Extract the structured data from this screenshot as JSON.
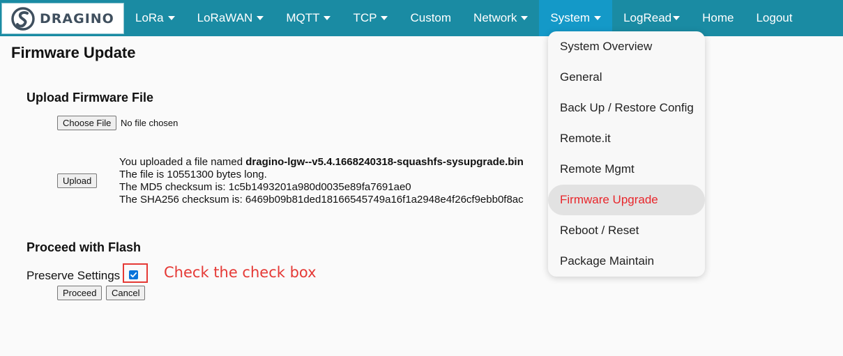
{
  "brand": {
    "logo_text": "DRAGINO",
    "logo_color": "#3f4f5e"
  },
  "colors": {
    "nav_bg": "#1a8ba3",
    "nav_active": "#1499c8",
    "annotation": "#e53935",
    "active_menu_text": "#e8262b"
  },
  "nav": {
    "lora": "LoRa",
    "lorawan": "LoRaWAN",
    "mqtt": "MQTT",
    "tcp": "TCP",
    "custom": "Custom",
    "network": "Network",
    "system": "System",
    "logread": "LogRead",
    "home": "Home",
    "logout": "Logout"
  },
  "page": {
    "title": "Firmware Update"
  },
  "upload": {
    "section_title": "Upload Firmware File",
    "choose_file_label": "Choose File",
    "no_file_text": "No file chosen",
    "upload_button": "Upload",
    "uploaded_prefix": "You uploaded a file named ",
    "uploaded_filename": "dragino-lgw--v5.4.1668240318-squashfs-sysupgrade.bin",
    "bytes_line": "The file is 10551300 bytes long.",
    "md5_line": "The MD5 checksum is: 1c5b1493201a980d0035e89fa7691ae0",
    "sha256_line": "The SHA256 checksum is: 6469b09b81ded18166545749a16f1a2948e4f26cf9ebb0f8ac"
  },
  "flash": {
    "section_title": "Proceed with Flash",
    "preserve_label": "Preserve Settings",
    "preserve_checked": true,
    "proceed_button": "Proceed",
    "cancel_button": "Cancel"
  },
  "annotation": {
    "text": "Check the check box"
  },
  "system_menu": {
    "items": [
      "System Overview",
      "General",
      "Back Up / Restore Config",
      "Remote.it",
      "Remote Mgmt",
      "Firmware Upgrade",
      "Reboot / Reset",
      "Package Maintain"
    ],
    "active_item": "Firmware Upgrade"
  }
}
